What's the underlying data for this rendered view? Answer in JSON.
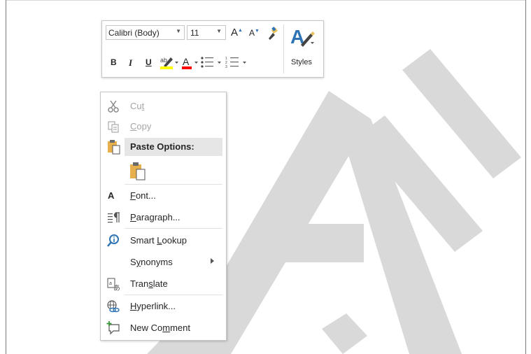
{
  "mini_toolbar": {
    "font_name": "Calibri (Body)",
    "font_size": "11",
    "grow_font_label": "A",
    "shrink_font_label": "A",
    "bold_label": "B",
    "italic_label": "I",
    "underline_label": "U",
    "font_color_label": "A",
    "styles_label": "Styles",
    "highlight_color": "#ffff00",
    "font_color": "#ff0000",
    "icons": [
      "format-painter-icon",
      "styles-icon",
      "highlight-icon",
      "font-color-icon",
      "bullets-icon",
      "numbering-icon"
    ]
  },
  "context_menu": {
    "cut": {
      "pre": "Cu",
      "ul": "t",
      "post": ""
    },
    "copy": {
      "pre": "",
      "ul": "C",
      "post": "opy"
    },
    "paste_options": "Paste Options:",
    "font": {
      "pre": "",
      "ul": "F",
      "post": "ont..."
    },
    "paragraph": {
      "pre": "",
      "ul": "P",
      "post": "aragraph..."
    },
    "smart_lookup": {
      "pre": "Smart ",
      "ul": "L",
      "post": "ookup"
    },
    "synonyms": {
      "pre": "S",
      "ul": "y",
      "post": "nonyms"
    },
    "translate": {
      "pre": "Tran",
      "ul": "s",
      "post": "late"
    },
    "hyperlink": {
      "pre": "",
      "ul": "H",
      "post": "yperlink..."
    },
    "new_comment": {
      "pre": "New Co",
      "ul": "m",
      "post": "ment"
    },
    "font_icon_letter": "A"
  },
  "watermark_color": "#d9d9d9"
}
